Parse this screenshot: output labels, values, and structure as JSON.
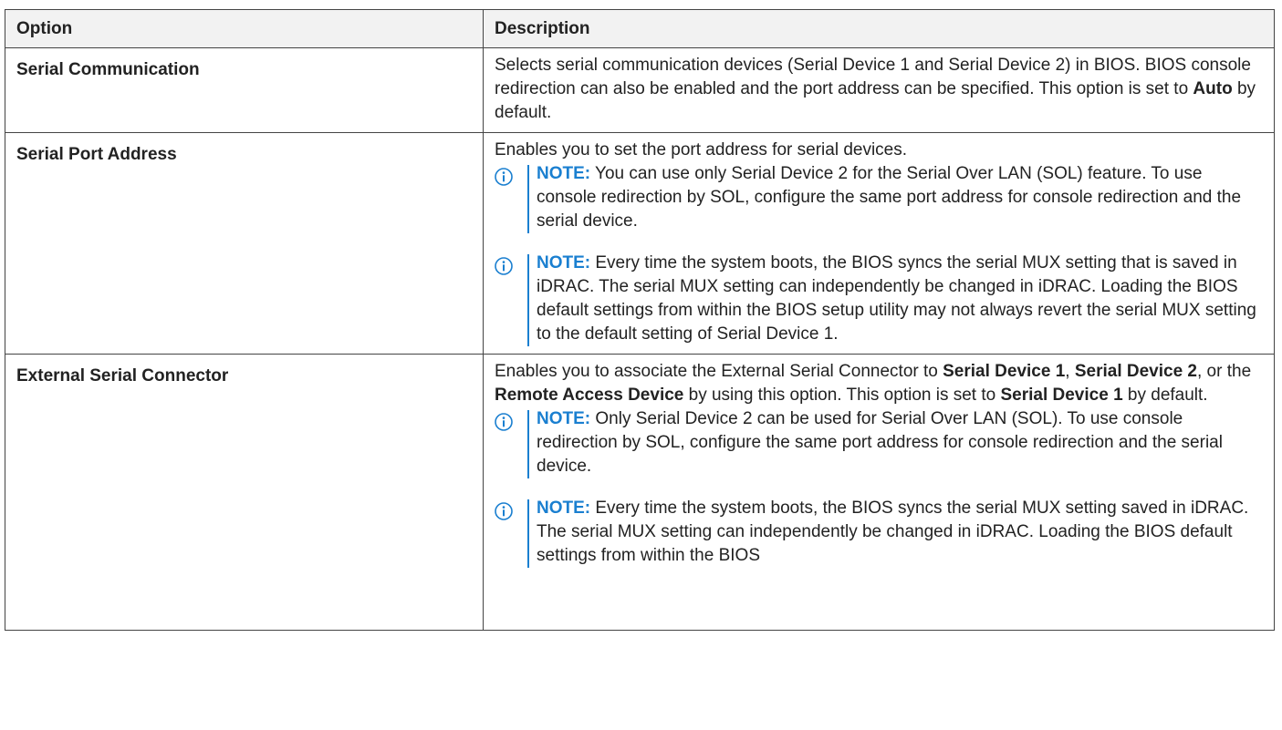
{
  "table": {
    "headers": {
      "option": "Option",
      "description": "Description"
    },
    "rows": [
      {
        "option": "Serial Communication",
        "desc_part1": "Selects serial communication devices (Serial Device 1 and Serial Device 2) in BIOS. BIOS console redirection can also be enabled and the port address can be specified. This option is set to ",
        "desc_bold1": "Auto",
        "desc_part2": " by default."
      },
      {
        "option": "Serial Port Address",
        "desc": "Enables you to set the port address for serial devices.",
        "notes": [
          {
            "label": "NOTE:",
            "text": " You can use only Serial Device 2 for the Serial Over LAN (SOL) feature. To use console redirection by SOL, configure the same port address for console redirection and the serial device."
          },
          {
            "label": "NOTE:",
            "text": " Every time the system boots, the BIOS syncs the serial MUX setting that is saved in iDRAC. The serial MUX setting can independently be changed in iDRAC. Loading the BIOS default settings from within the BIOS setup utility may not always revert the serial MUX setting to the default setting of Serial Device 1."
          }
        ]
      },
      {
        "option": "External Serial Connector",
        "desc_a": "Enables you to associate the External Serial Connector to ",
        "desc_b1": "Serial Device 1",
        "desc_c": ", ",
        "desc_b2": "Serial Device 2",
        "desc_d": ", or the ",
        "desc_b3": "Remote Access Device",
        "desc_e": " by using this option. This option is set to ",
        "desc_b4": "Serial Device 1",
        "desc_f": " by default.",
        "notes": [
          {
            "label": "NOTE:",
            "text": " Only Serial Device 2 can be used for Serial Over LAN (SOL). To use console redirection by SOL, configure the same port address for console redirection and the serial device."
          },
          {
            "label": "NOTE:",
            "text": " Every time the system boots, the BIOS syncs the serial MUX setting saved in iDRAC. The serial MUX setting can independently be changed in iDRAC. Loading the BIOS default settings from within the BIOS"
          }
        ]
      }
    ]
  },
  "colors": {
    "note_accent": "#1a7fd0",
    "header_bg": "#f2f2f2",
    "border": "#444444"
  },
  "icons": {
    "note": "info-circle-icon"
  }
}
